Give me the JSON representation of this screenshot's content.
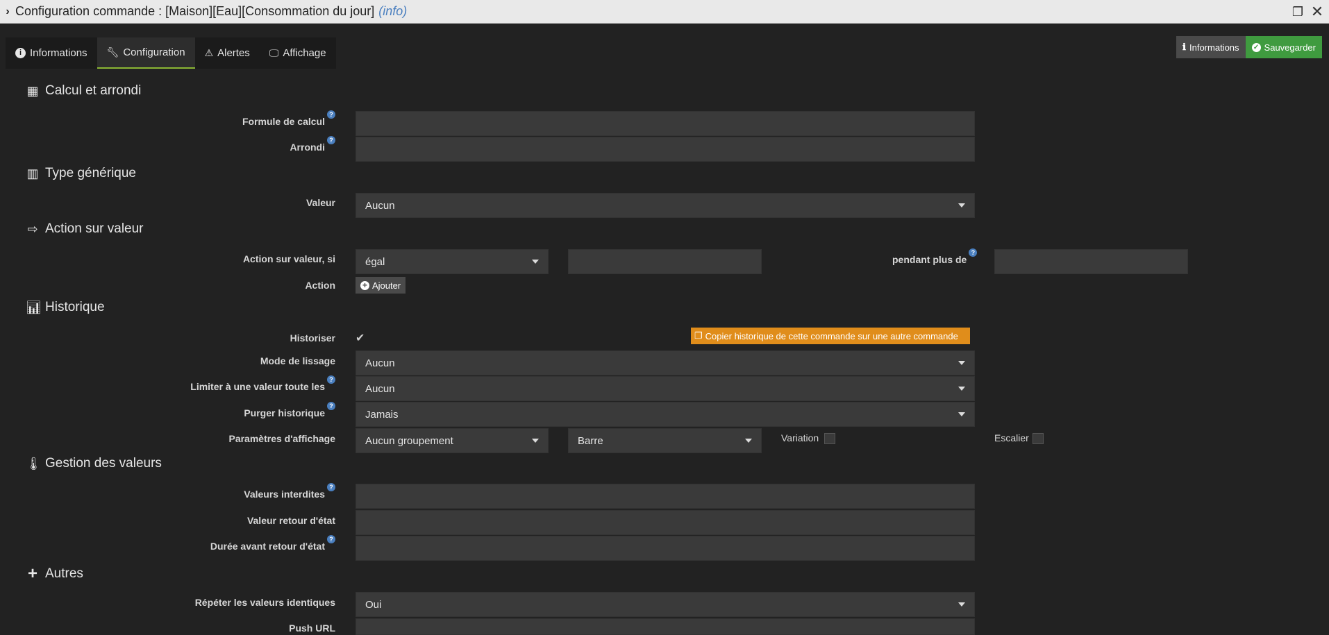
{
  "window": {
    "title": "Configuration commande : [Maison][Eau][Consommation du jour]",
    "type_label": "(info)"
  },
  "tabs": [
    {
      "label": "Informations",
      "icon": "info-circle-icon"
    },
    {
      "label": "Configuration",
      "icon": "wrench-icon",
      "active": true
    },
    {
      "label": "Alertes",
      "icon": "warning-icon"
    },
    {
      "label": "Affichage",
      "icon": "monitor-icon"
    }
  ],
  "top_buttons": {
    "info_label": "Informations",
    "save_label": "Sauvegarder"
  },
  "sections": {
    "calcul": "Calcul et arrondi",
    "type": "Type générique",
    "action": "Action sur valeur",
    "historique": "Historique",
    "gestion": "Gestion des valeurs",
    "autres": "Autres"
  },
  "calcul": {
    "formule_label": "Formule de calcul",
    "formule_value": "",
    "arrondi_label": "Arrondi",
    "arrondi_value": ""
  },
  "type": {
    "valeur_label": "Valeur",
    "valeur_value": "Aucun"
  },
  "action": {
    "condition_label": "Action sur valeur, si",
    "operator_value": "égal",
    "compare_value": "",
    "pendant_label": "pendant plus de",
    "pendant_value": "",
    "action_label": "Action",
    "add_label": "Ajouter"
  },
  "historique": {
    "historiser_label": "Historiser",
    "historiser_checked": true,
    "copy_label": "Copier historique de cette commande sur une autre commande",
    "lissage_label": "Mode de lissage",
    "lissage_value": "Aucun",
    "limiter_label": "Limiter à une valeur toute les",
    "limiter_value": "Aucun",
    "purger_label": "Purger historique",
    "purger_value": "Jamais",
    "params_label": "Paramètres d'affichage",
    "groupement_value": "Aucun groupement",
    "graph_value": "Barre",
    "variation_label": "Variation",
    "variation_checked": false,
    "escalier_label": "Escalier",
    "escalier_checked": false
  },
  "gestion": {
    "interdites_label": "Valeurs interdites",
    "interdites_value": "",
    "retour_label": "Valeur retour d'état",
    "retour_value": "",
    "duree_label": "Durée avant retour d'état",
    "duree_value": ""
  },
  "autres": {
    "repeter_label": "Répéter les valeurs identiques",
    "repeter_value": "Oui",
    "push_label": "Push URL",
    "push_value": ""
  },
  "colors": {
    "background": "#222222",
    "input": "#3a3a3a",
    "save_green": "#3f9b3f",
    "copy_orange": "#e08d1b",
    "help_blue": "#4a7fbf",
    "active_tab_accent": "#8bb634"
  }
}
